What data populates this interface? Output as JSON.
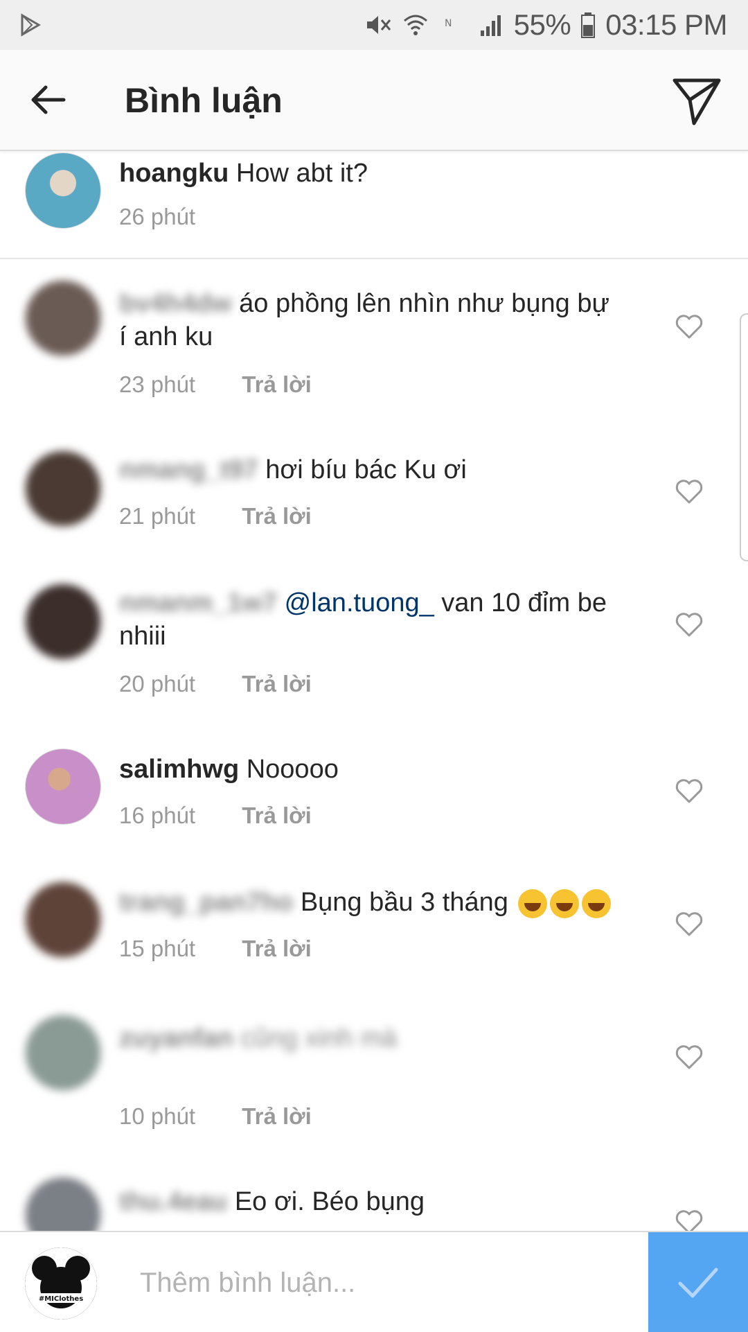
{
  "status_bar": {
    "battery": "55%",
    "time": "03:15 PM",
    "icons": [
      "play-store-icon",
      "mute-icon",
      "wifi-icon",
      "nfc-icon",
      "signal-icon",
      "battery-icon"
    ]
  },
  "header": {
    "title": "Bình luận",
    "icons": [
      "back-arrow-icon",
      "send-direct-icon"
    ]
  },
  "caption": {
    "username": "hoangku",
    "text": "How abt it?",
    "time": "26 phút"
  },
  "reply_label": "Trả lời",
  "comments": [
    {
      "username": "bv4h4dw",
      "text": "áo phồng lên nhìn như bụng bự",
      "text2": "í anh ku",
      "time": "23 phút",
      "avatar_color": "#6b5b55"
    },
    {
      "username": "nmang_t97",
      "text": "hơi bíu bác Ku ơi",
      "time": "21 phút",
      "avatar_color": "#4a3a33"
    },
    {
      "username": "nmanm_1w7",
      "mention": "@lan.tuong_",
      "text": " van 10 đỉm be",
      "text2": "nhiii",
      "time": "20 phút",
      "avatar_color": "#3b2e2b"
    },
    {
      "username": "salimhwg",
      "text": "Nooooo",
      "time": "16 phút",
      "avatar_color": "#e4b7d9"
    },
    {
      "username": "trang_pan7ho",
      "text": "Bụng bầu 3 tháng",
      "time": "15 phút",
      "avatar_color": "#5e4339"
    },
    {
      "username": "zuyanfan",
      "text": "cũng xinh mà",
      "time": "10 phút",
      "avatar_color": "#8a9a95"
    },
    {
      "username": "thu.4eau",
      "text": "Eo ơi. Béo bụng",
      "time": "",
      "avatar_color": "#7b7f86"
    }
  ],
  "composer": {
    "placeholder": "Thêm bình luận...",
    "avatar_label": "#MIClothes",
    "accent": "#3897f0"
  }
}
